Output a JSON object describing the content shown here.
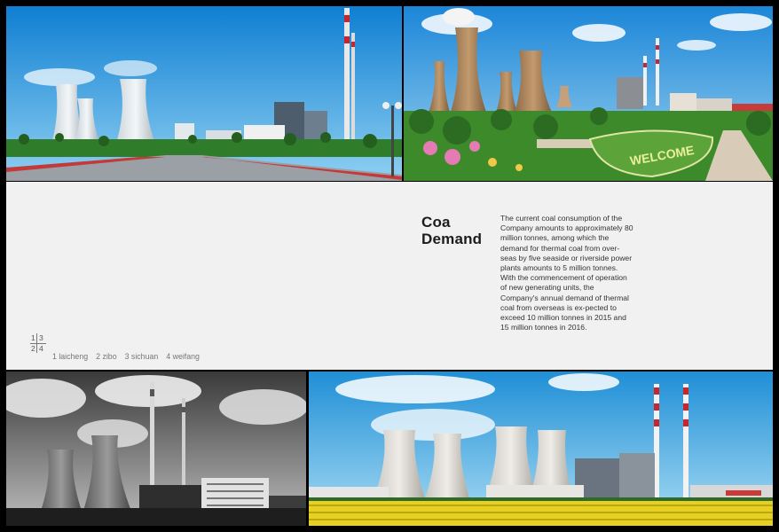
{
  "article": {
    "title_line1": "Coa",
    "title_line2": "Demand",
    "body": "The current coal consumption of the Company amounts to approximately 80 million tonnes, among which the demand for thermal coal from over-seas by five seaside or riverside power plants amounts to 5 million tonnes. With the commencement of operation of new generating units, the Company's annual demand of thermal coal from overseas is ex-pected to exceed 10 million tonnes in 2015 and 15 million tonnes in 2016."
  },
  "photo_legend": {
    "grid": [
      "1",
      "3",
      "2",
      "4"
    ],
    "captions": [
      "1 laicheng",
      "2 zibo",
      "3 sichuan",
      "4 weifang"
    ]
  },
  "photo_1": {
    "sign": ""
  },
  "photo_2": {
    "sign": "WELCOME"
  },
  "colors": {
    "sky_blue": "#1f8fd6",
    "grass_green": "#3d8a2a",
    "field_yellow": "#e7d021",
    "chimney_red": "#c8262c"
  }
}
